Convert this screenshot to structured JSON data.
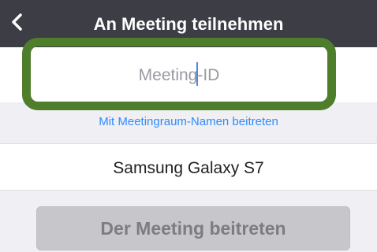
{
  "header": {
    "title": "An Meeting teilnehmen",
    "back_icon": "chevron-left-icon"
  },
  "meeting_input": {
    "placeholder": "Meeting-ID",
    "value": ""
  },
  "room_link": {
    "label": "Mit Meetingraum-Namen beitreten"
  },
  "device": {
    "name": "Samsung Galaxy S7"
  },
  "join_button": {
    "label": "Der Meeting beitreten",
    "enabled": false
  },
  "colors": {
    "header_bg": "#3d3d46",
    "link": "#2d8cff",
    "highlight": "#4e7d2c",
    "button_disabled_bg": "#c6c6cb"
  }
}
